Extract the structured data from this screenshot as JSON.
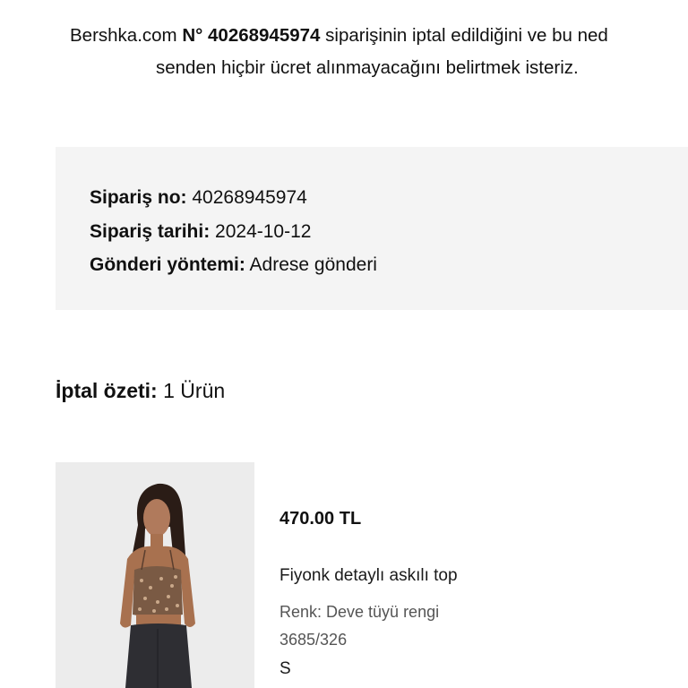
{
  "intro": {
    "line1_prefix": "Bershka.com ",
    "line1_order_label": "N° 40268945974",
    "line1_suffix": " siparişinin iptal edildiğini ve bu ned",
    "line2": "senden hiçbir ücret alınmayacağını belirtmek isteriz."
  },
  "order": {
    "number_label": "Sipariş no:",
    "number_value": "40268945974",
    "date_label": "Sipariş tarihi:",
    "date_value": "2024-10-12",
    "shipping_label": "Gönderi yöntemi:",
    "shipping_value": "Adrese gönderi"
  },
  "summary": {
    "label": "İptal özeti:",
    "value": "1 Ürün"
  },
  "product": {
    "price": "470.00 TL",
    "name": "Fiyonk detaylı askılı top",
    "color": "Renk: Deve tüyü rengi",
    "reference": "3685/326",
    "size": "S"
  },
  "colors": {
    "box_background": "#f4f4f4",
    "text": "#111111",
    "muted_text": "#555555"
  }
}
